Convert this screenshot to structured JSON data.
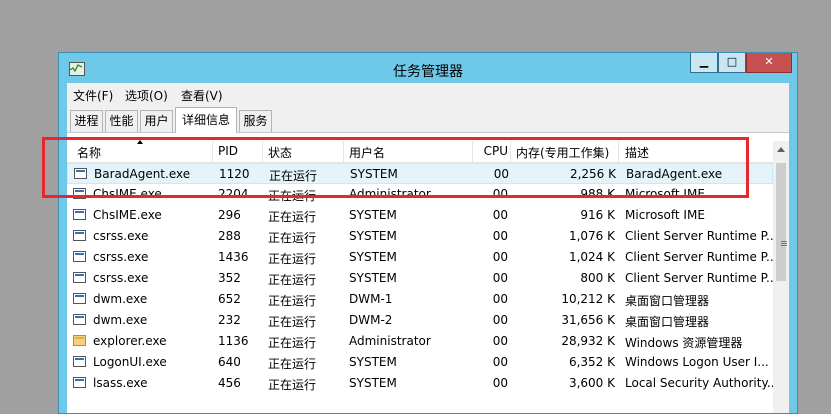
{
  "window": {
    "title": "任务管理器",
    "controls": {
      "minimize": "▁",
      "maximize": "□",
      "close": "✕"
    },
    "close_color": "#c75050",
    "frame_color": "#6ec8e8"
  },
  "menu": [
    "文件(F)",
    "选项(O)",
    "查看(V)"
  ],
  "tabs": [
    {
      "label": "进程",
      "active": false
    },
    {
      "label": "性能",
      "active": false
    },
    {
      "label": "用户",
      "active": false
    },
    {
      "label": "详细信息",
      "active": true
    },
    {
      "label": "服务",
      "active": false
    }
  ],
  "table": {
    "columns": [
      "名称",
      "PID",
      "状态",
      "用户名",
      "CPU",
      "内存(专用工作集)",
      "描述"
    ],
    "sorted_column": "名称",
    "rows": [
      {
        "name": "BaradAgent.exe",
        "pid": "1120",
        "status": "正在运行",
        "user": "SYSTEM",
        "cpu": "00",
        "mem": "2,256 K",
        "desc": "BaradAgent.exe",
        "icon": "app-icon",
        "selected": true
      },
      {
        "name": "ChsIME.exe",
        "pid": "2204",
        "status": "正在运行",
        "user": "Administrator",
        "cpu": "00",
        "mem": "988 K",
        "desc": "Microsoft IME",
        "icon": "app-icon",
        "selected": false
      },
      {
        "name": "ChsIME.exe",
        "pid": "296",
        "status": "正在运行",
        "user": "SYSTEM",
        "cpu": "00",
        "mem": "916 K",
        "desc": "Microsoft IME",
        "icon": "app-icon",
        "selected": false
      },
      {
        "name": "csrss.exe",
        "pid": "288",
        "status": "正在运行",
        "user": "SYSTEM",
        "cpu": "00",
        "mem": "1,076 K",
        "desc": "Client Server Runtime P...",
        "icon": "app-icon",
        "selected": false
      },
      {
        "name": "csrss.exe",
        "pid": "1436",
        "status": "正在运行",
        "user": "SYSTEM",
        "cpu": "00",
        "mem": "1,024 K",
        "desc": "Client Server Runtime P...",
        "icon": "app-icon",
        "selected": false
      },
      {
        "name": "csrss.exe",
        "pid": "352",
        "status": "正在运行",
        "user": "SYSTEM",
        "cpu": "00",
        "mem": "800 K",
        "desc": "Client Server Runtime P...",
        "icon": "app-icon",
        "selected": false
      },
      {
        "name": "dwm.exe",
        "pid": "652",
        "status": "正在运行",
        "user": "DWM-1",
        "cpu": "00",
        "mem": "10,212 K",
        "desc": "桌面窗口管理器",
        "icon": "app-icon",
        "selected": false
      },
      {
        "name": "dwm.exe",
        "pid": "232",
        "status": "正在运行",
        "user": "DWM-2",
        "cpu": "00",
        "mem": "31,656 K",
        "desc": "桌面窗口管理器",
        "icon": "app-icon",
        "selected": false
      },
      {
        "name": "explorer.exe",
        "pid": "1136",
        "status": "正在运行",
        "user": "Administrator",
        "cpu": "00",
        "mem": "28,932 K",
        "desc": "Windows 资源管理器",
        "icon": "folder-icon",
        "selected": false
      },
      {
        "name": "LogonUI.exe",
        "pid": "640",
        "status": "正在运行",
        "user": "SYSTEM",
        "cpu": "00",
        "mem": "6,352 K",
        "desc": "Windows Logon User I...",
        "icon": "app-icon",
        "selected": false
      },
      {
        "name": "lsass.exe",
        "pid": "456",
        "status": "正在运行",
        "user": "SYSTEM",
        "cpu": "00",
        "mem": "3,600 K",
        "desc": "Local Security Authority...",
        "icon": "app-icon",
        "selected": false
      }
    ]
  },
  "annotation": {
    "color": "#e8262b"
  }
}
